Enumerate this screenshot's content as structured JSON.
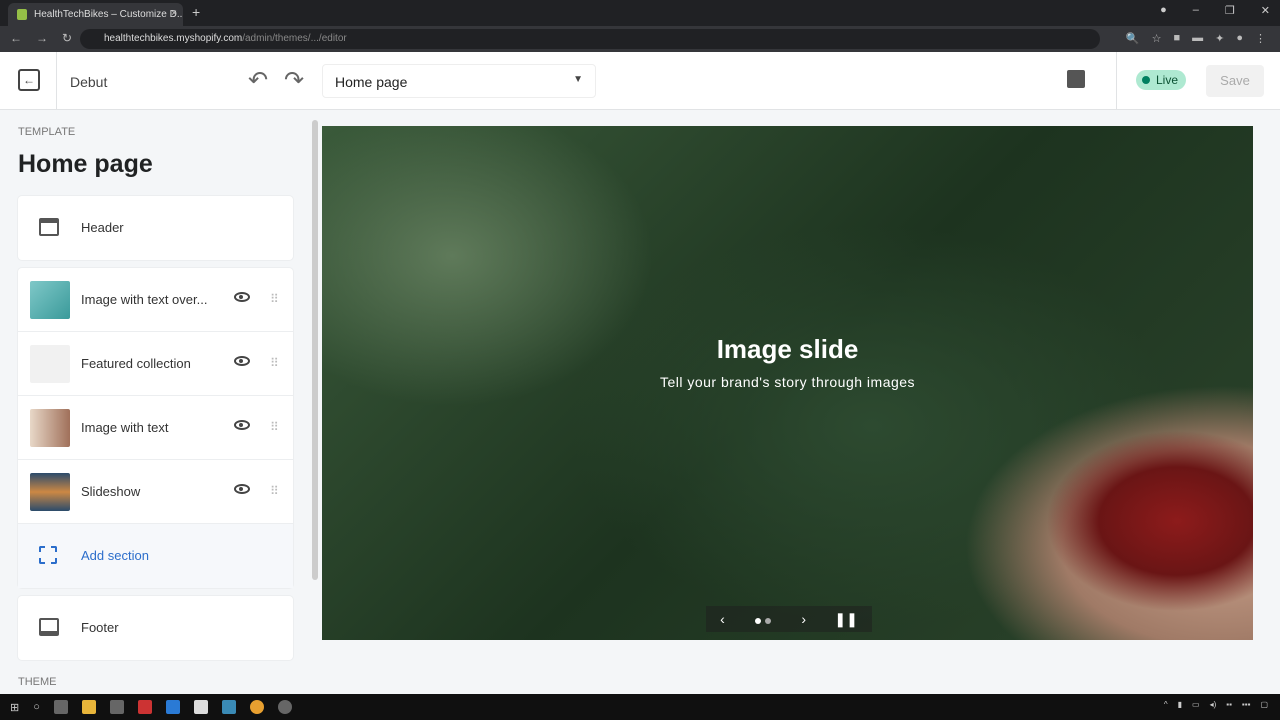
{
  "browser": {
    "tab_title": "HealthTechBikes – Customize D...",
    "url_host": "healthtechbikes.myshopify.com",
    "url_path": "/admin/themes/.../editor"
  },
  "topbar": {
    "theme": "Debut",
    "page_select": "Home page",
    "status": "Live",
    "save": "Save"
  },
  "sidebar": {
    "template_label": "TEMPLATE",
    "title": "Home page",
    "header": "Header",
    "sections": [
      {
        "label": "Image with text over..."
      },
      {
        "label": "Featured collection"
      },
      {
        "label": "Image with text"
      },
      {
        "label": "Slideshow"
      }
    ],
    "add_section": "Add section",
    "footer": "Footer",
    "theme_label": "THEME"
  },
  "preview": {
    "title": "Image slide",
    "subtitle": "Tell your brand's story through images",
    "slides_total": 2,
    "slide_current": 1
  }
}
